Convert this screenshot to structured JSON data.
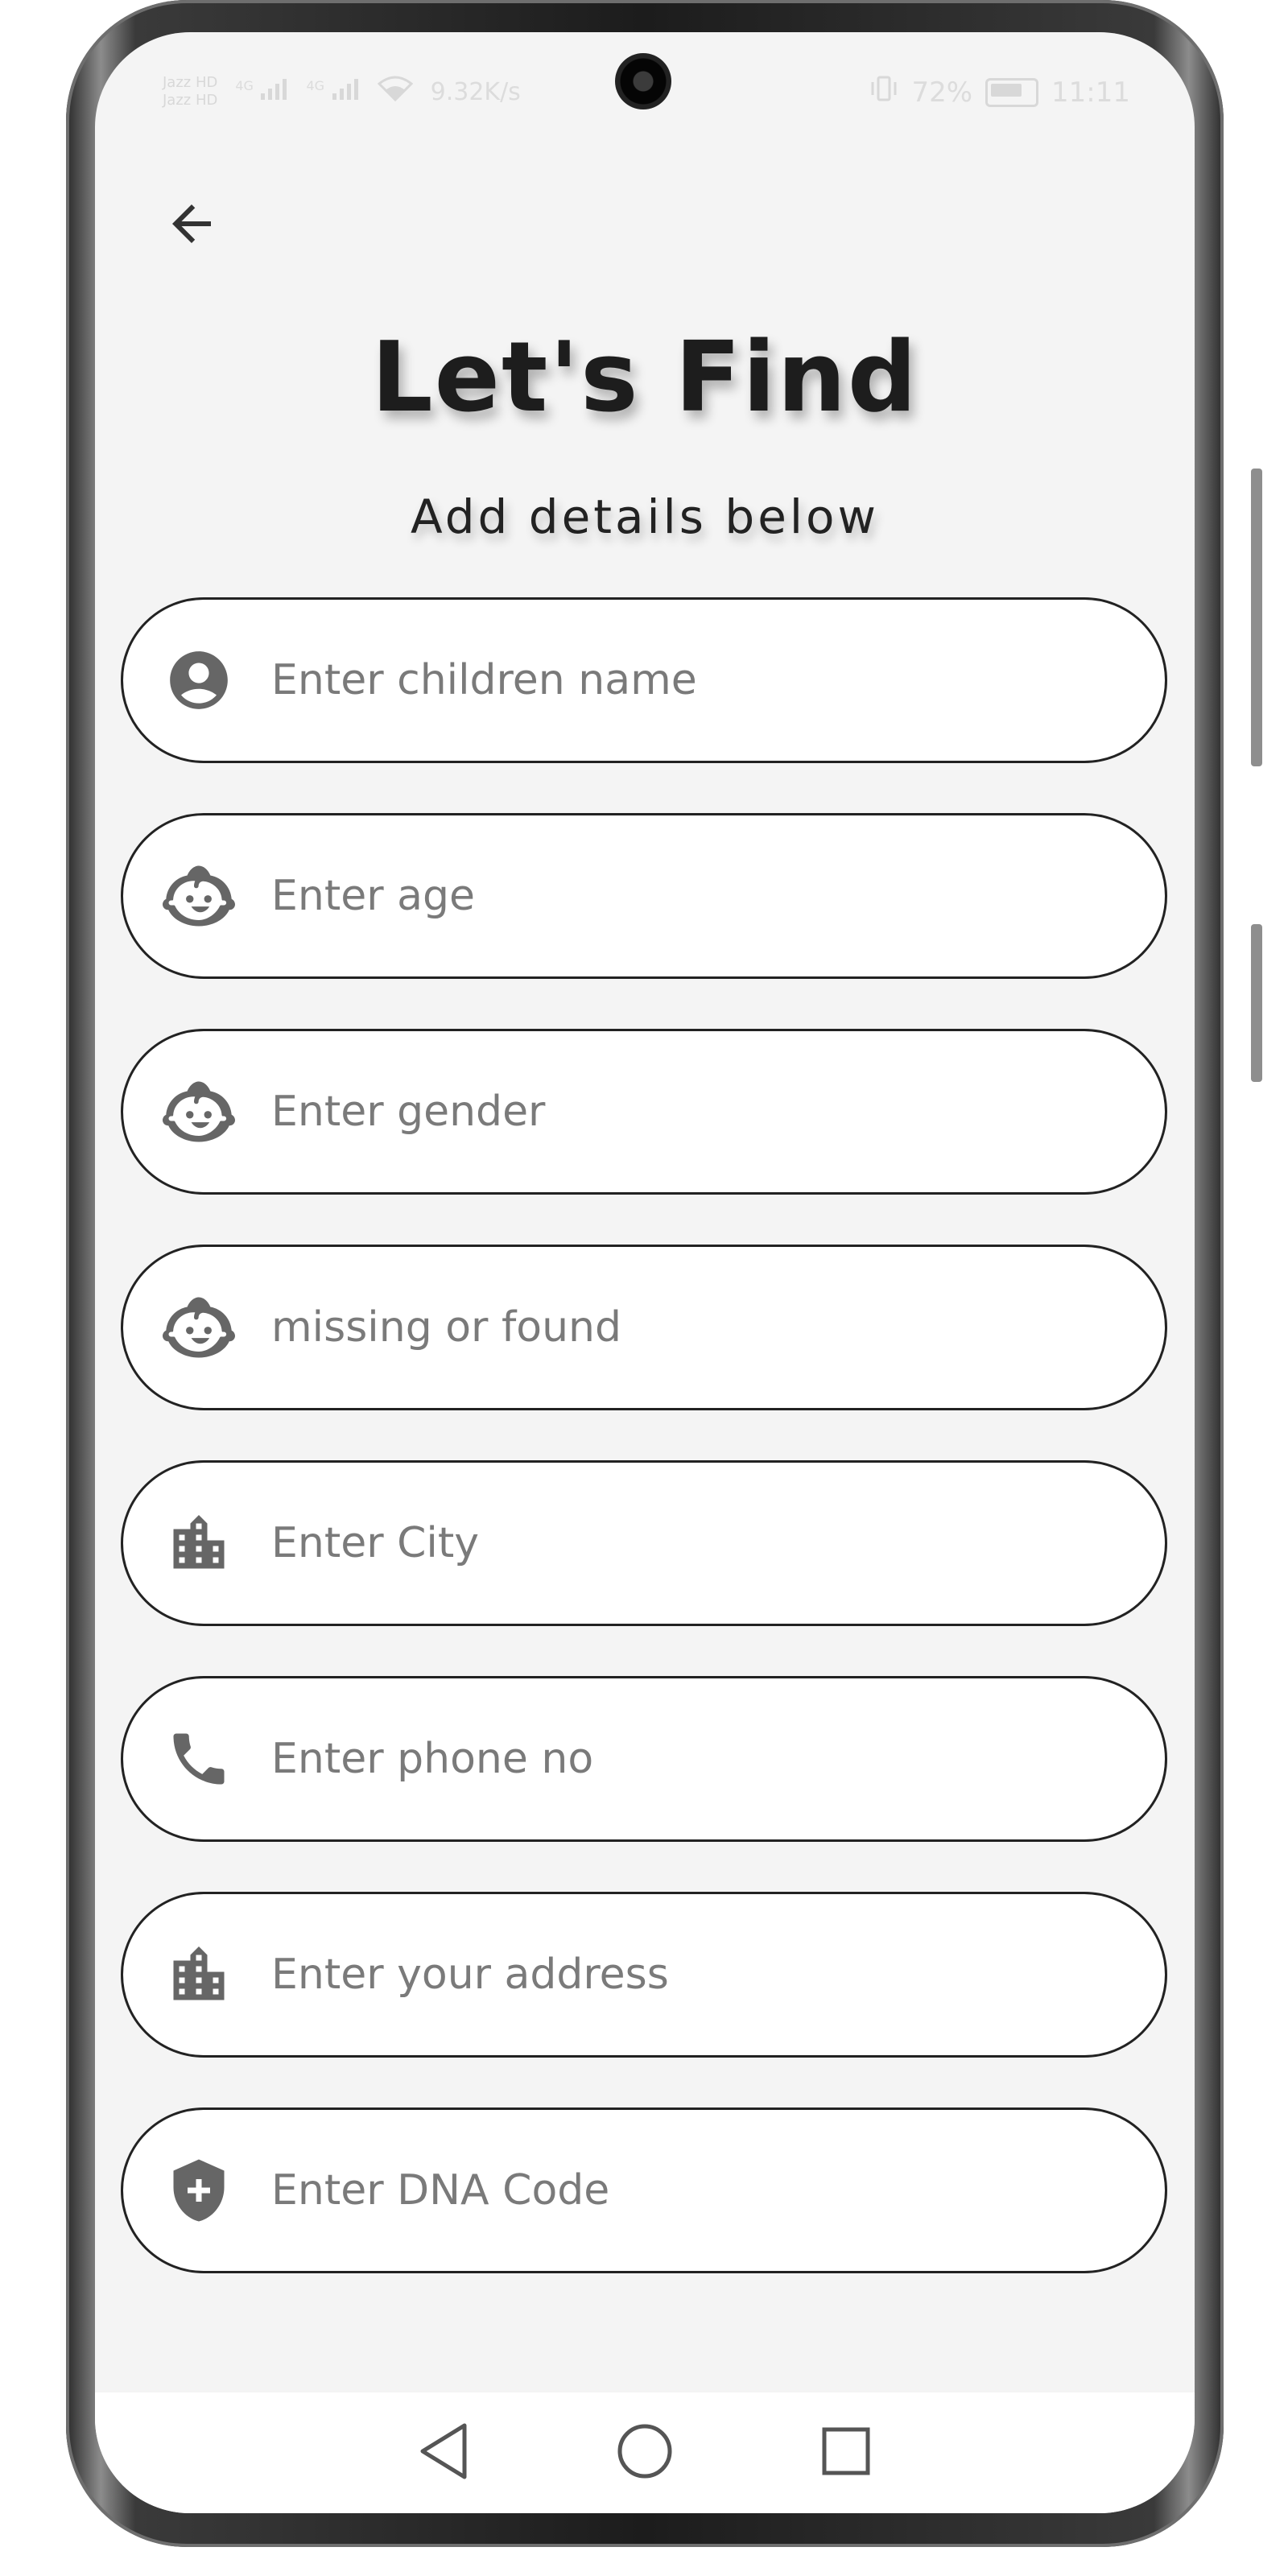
{
  "status_bar": {
    "sim1": "Jazz HD",
    "sim2": "Jazz HD",
    "net1": "4G",
    "net2": "4G",
    "speed": "9.32K/s",
    "battery": "72%",
    "time": "11:11"
  },
  "header": {
    "back_icon": "arrow-left-icon",
    "title": "Let's Find",
    "subtitle": "Add details below"
  },
  "form": {
    "fields": [
      {
        "icon": "account-circle-icon",
        "placeholder": "Enter children name",
        "value": ""
      },
      {
        "icon": "child-face-icon",
        "placeholder": "Enter age",
        "value": ""
      },
      {
        "icon": "child-face-icon",
        "placeholder": "Enter gender",
        "value": ""
      },
      {
        "icon": "child-face-icon",
        "placeholder": "missing or found",
        "value": ""
      },
      {
        "icon": "city-icon",
        "placeholder": "Enter City",
        "value": ""
      },
      {
        "icon": "phone-icon",
        "placeholder": "Enter phone no",
        "value": ""
      },
      {
        "icon": "city-icon",
        "placeholder": "Enter your address",
        "value": ""
      },
      {
        "icon": "shield-plus-icon",
        "placeholder": "Enter DNA Code",
        "value": ""
      }
    ]
  },
  "nav_bar": {
    "back": "triangle-back-icon",
    "home": "circle-home-icon",
    "recents": "square-recents-icon"
  },
  "colors": {
    "background": "#f4f4f4",
    "field_border": "#222222",
    "icon": "#666666",
    "placeholder": "#7a7a7a"
  }
}
